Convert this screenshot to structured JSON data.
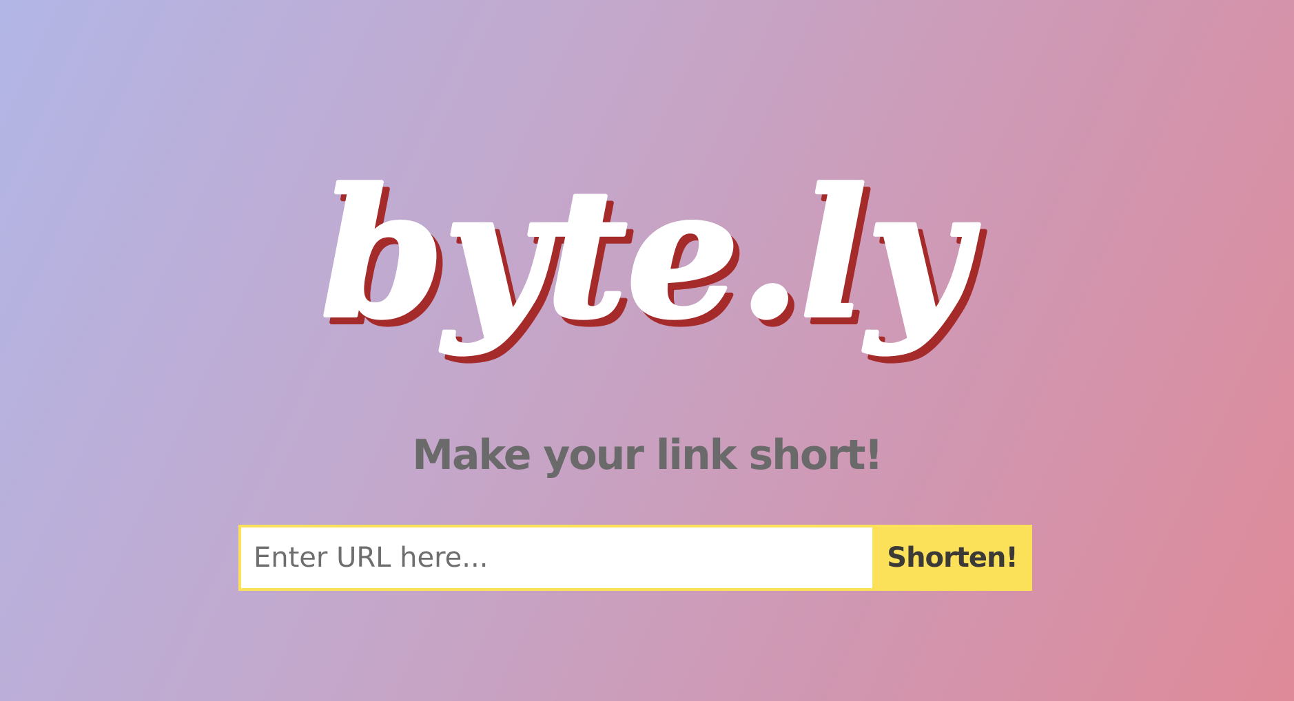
{
  "logo": {
    "text": "byte.ly",
    "fill_color": "#ffffff",
    "shadow_color": "#a52a2a"
  },
  "tagline": "Make your link short!",
  "form": {
    "input_placeholder": "Enter URL here...",
    "input_value": "",
    "button_label": "Shorten!"
  },
  "colors": {
    "background_start": "#b2b6e6",
    "background_end": "#de8a98",
    "accent": "#fbe05a",
    "tagline": "#6a6a6a"
  }
}
